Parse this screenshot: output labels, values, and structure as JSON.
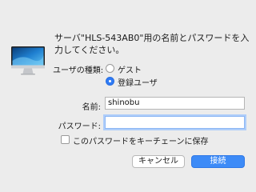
{
  "dialog": {
    "message": "サーバ\"HLS-543AB0\"用の名前とパスワードを入力してください。",
    "user_type_label": "ユーザの種類:",
    "options": [
      {
        "label": "ゲスト",
        "selected": false
      },
      {
        "label": "登録ユーザ",
        "selected": true
      }
    ],
    "name_label": "名前:",
    "name_value": "shinobu",
    "password_label": "パスワード:",
    "password_value": "",
    "keychain_label": "このパスワードをキーチェーンに保存",
    "keychain_checked": false,
    "cancel_label": "キャンセル",
    "connect_label": "接続",
    "accent_color": "#3d8bf7",
    "icon": "imac-icon"
  }
}
